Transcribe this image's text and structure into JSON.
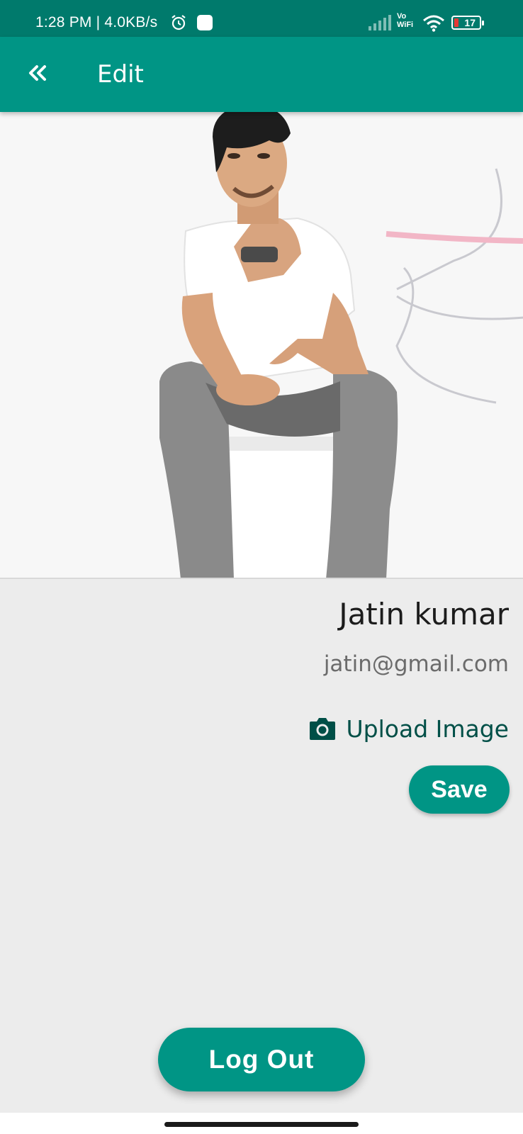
{
  "status_bar": {
    "time": "1:28 PM | 4.0KB/s",
    "vowifi_top": "Vo",
    "vowifi_bottom": "WiFi",
    "battery": "17"
  },
  "app_bar": {
    "title": "Edit",
    "back_icon": "double-chevron-left-icon"
  },
  "profile": {
    "name": "Jatin kumar",
    "email": "jatin@gmail.com",
    "upload_label": "Upload Image",
    "upload_icon": "camera-icon",
    "save_label": "Save"
  },
  "footer": {
    "logout_label": "Log Out"
  },
  "colors": {
    "primary": "#009585",
    "status_bar": "#007a6c",
    "upload_text": "#004f47",
    "background": "#ececec"
  }
}
